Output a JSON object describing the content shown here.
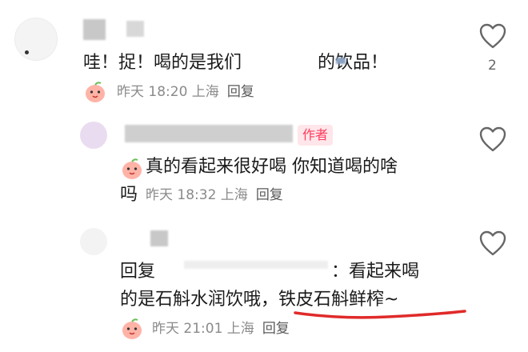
{
  "comments": [
    {
      "text": "哇！捉！喝的是我们",
      "text_tail": "的饮品！",
      "meta_time": "昨天 18:20 上海",
      "reply_label": "回复",
      "like_count": "2"
    },
    {
      "author_badge": "作者",
      "text_line1": "真的看起来很好喝 你知道喝的啥",
      "text_line2": "吗",
      "meta_time": "昨天 18:32 上海",
      "reply_label": "回复"
    },
    {
      "text_line1_prefix": "回复",
      "text_line1_suffix": "：看起来喝",
      "text_line2_main": "的是石斛水润饮哦，",
      "text_line2_highlight": "铁皮石斛鲜榨~",
      "meta_time": "昨天 21:01 上海",
      "reply_label": "回复"
    }
  ],
  "colors": {
    "underline": "#e02a2a",
    "author_badge": "#ff3b5c",
    "meta": "#8a8a8a"
  },
  "icons": [
    "heart-outline-icon",
    "peach-emoji-icon",
    "blurred-username"
  ]
}
